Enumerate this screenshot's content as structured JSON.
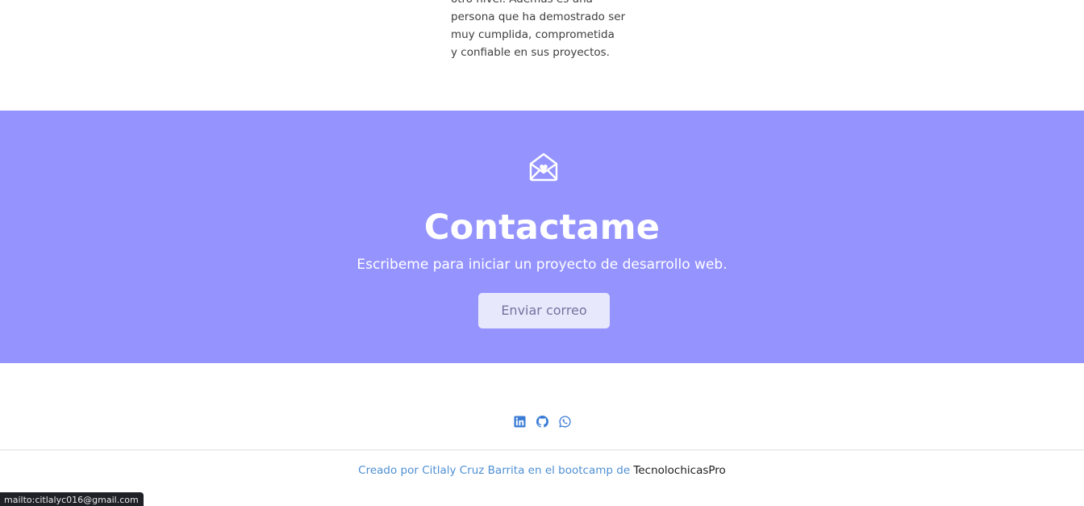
{
  "testimonial": {
    "lines": [
      "otro nivel. Además es una",
      "persona que ha demostrado ser",
      "muy cumplida, comprometida",
      "y confiable en sus proyectos."
    ]
  },
  "contact": {
    "icon": "envelope-heart-icon",
    "title": "Contactame",
    "subtitle": "Escribeme para iniciar un proyecto de desarrollo web.",
    "button_label": "Enviar correo",
    "background_color": "#9594ff"
  },
  "footer": {
    "social_icons": [
      "linkedin-icon",
      "github-icon",
      "whatsapp-icon"
    ],
    "credit_text": "Creado por Citlaly Cruz Barrita en el bootcamp de ",
    "credit_link": "TecnolochicasPro",
    "accent_color": "#4e8fd3"
  },
  "status_bar": {
    "url": "mailto:citlalyc016@gmail.com"
  }
}
